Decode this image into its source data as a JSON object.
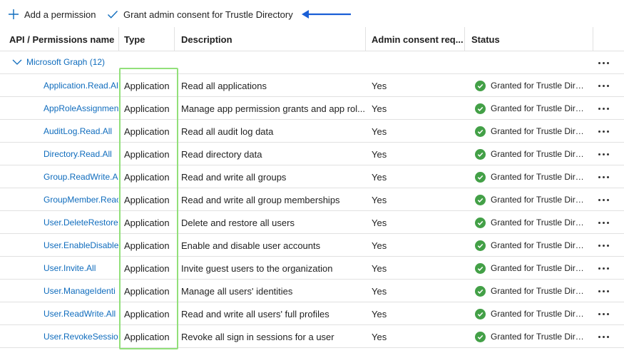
{
  "toolbar": {
    "add_label": "Add a permission",
    "add_icon": "plus-icon",
    "grant_label": "Grant admin consent for Trustle Directory",
    "grant_icon": "checkmark-icon",
    "arrow_icon": "arrow-left-icon",
    "arrow_color": "#1a5fd6"
  },
  "table": {
    "columns": [
      "API / Permissions name",
      "Type",
      "Description",
      "Admin consent req...",
      "Status"
    ],
    "group": {
      "label": "Microsoft Graph (12)",
      "icon": "chevron-down-icon"
    },
    "rows": [
      {
        "name": "Application.Read.Al",
        "type": "Application",
        "description": "Read all applications",
        "admin": "Yes",
        "status": "Granted for Trustle Dire..."
      },
      {
        "name": "AppRoleAssignmen",
        "type": "Application",
        "description": "Manage app permission grants and app rol...",
        "admin": "Yes",
        "status": "Granted for Trustle Dire..."
      },
      {
        "name": "AuditLog.Read.All",
        "type": "Application",
        "description": "Read all audit log data",
        "admin": "Yes",
        "status": "Granted for Trustle Dire..."
      },
      {
        "name": "Directory.Read.All",
        "type": "Application",
        "description": "Read directory data",
        "admin": "Yes",
        "status": "Granted for Trustle Dire..."
      },
      {
        "name": "Group.ReadWrite.Al",
        "type": "Application",
        "description": "Read and write all groups",
        "admin": "Yes",
        "status": "Granted for Trustle Dire..."
      },
      {
        "name": "GroupMember.Reac",
        "type": "Application",
        "description": "Read and write all group memberships",
        "admin": "Yes",
        "status": "Granted for Trustle Dire..."
      },
      {
        "name": "User.DeleteRestore.",
        "type": "Application",
        "description": "Delete and restore all users",
        "admin": "Yes",
        "status": "Granted for Trustle Dire..."
      },
      {
        "name": "User.EnableDisable/",
        "type": "Application",
        "description": "Enable and disable user accounts",
        "admin": "Yes",
        "status": "Granted for Trustle Dire..."
      },
      {
        "name": "User.Invite.All",
        "type": "Application",
        "description": "Invite guest users to the organization",
        "admin": "Yes",
        "status": "Granted for Trustle Dire..."
      },
      {
        "name": "User.ManageIdenti",
        "type": "Application",
        "description": "Manage all users' identities",
        "admin": "Yes",
        "status": "Granted for Trustle Dire..."
      },
      {
        "name": "User.ReadWrite.All",
        "type": "Application",
        "description": "Read and write all users' full profiles",
        "admin": "Yes",
        "status": "Granted for Trustle Dire..."
      },
      {
        "name": "User.RevokeSession",
        "type": "Application",
        "description": "Revoke all sign in sessions for a user",
        "admin": "Yes",
        "status": "Granted for Trustle Dire..."
      }
    ]
  },
  "colors": {
    "link": "#0f6cbd",
    "granted": "#43a047",
    "highlight": "#92e07a"
  }
}
